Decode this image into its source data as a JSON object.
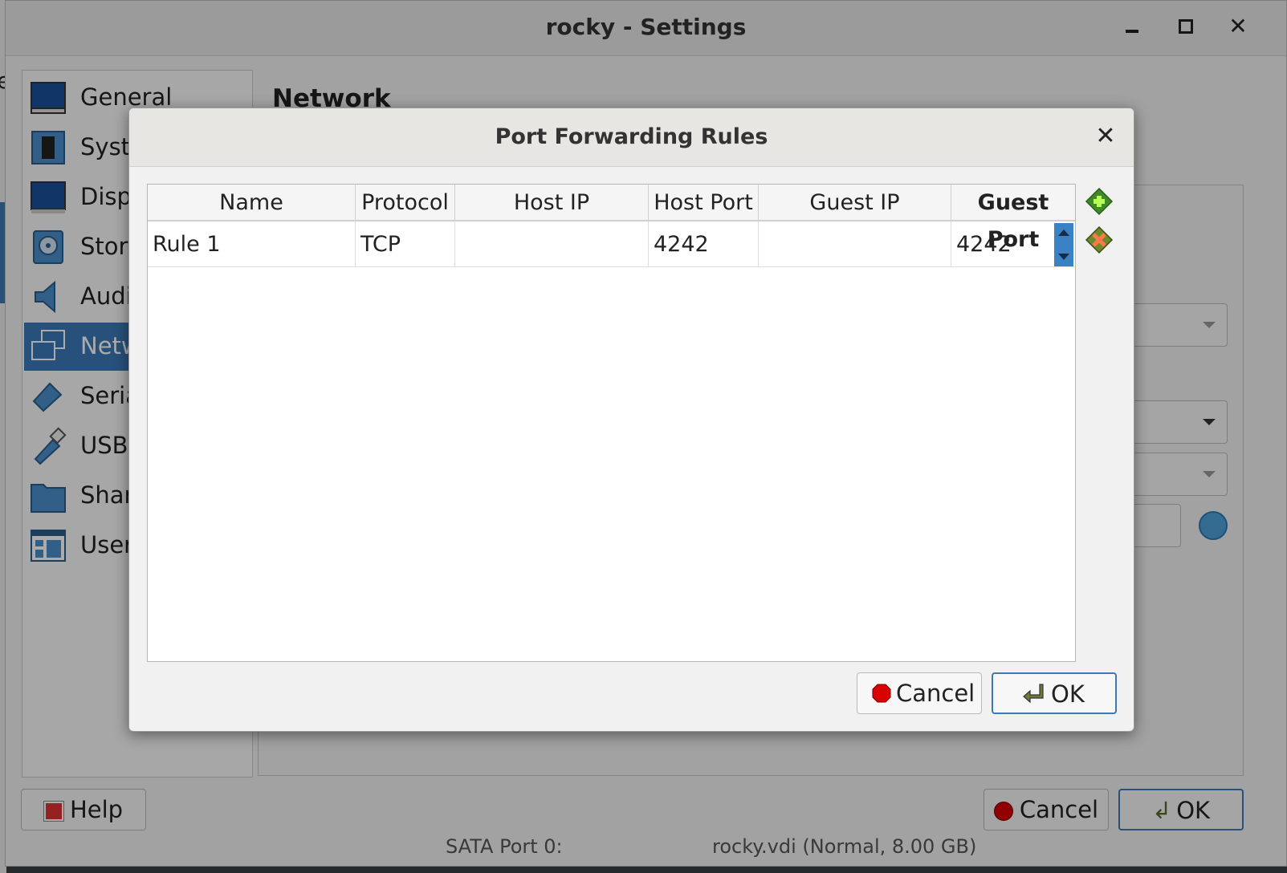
{
  "window": {
    "title": "rocky - Settings",
    "partial_left_edge_text": "e"
  },
  "sidebar": {
    "items": [
      {
        "label": "General",
        "icon": "monitor-general-icon"
      },
      {
        "label": "System",
        "icon": "chip-icon"
      },
      {
        "label": "Display",
        "icon": "display-icon"
      },
      {
        "label": "Storage",
        "icon": "disk-icon"
      },
      {
        "label": "Audio",
        "icon": "speaker-icon"
      },
      {
        "label": "Network",
        "icon": "network-icon",
        "selected": true
      },
      {
        "label": "Serial Ports",
        "icon": "serial-port-icon"
      },
      {
        "label": "USB",
        "icon": "usb-icon"
      },
      {
        "label": "Shared Folders",
        "icon": "folder-icon"
      },
      {
        "label": "User Interface",
        "icon": "user-interface-icon"
      }
    ],
    "visible_labels": [
      "General",
      "Syste",
      "Displ",
      "Stora",
      "Audi",
      "Netw",
      "Seria",
      "USB",
      "Share",
      "User"
    ]
  },
  "main": {
    "section_title": "Network"
  },
  "bottom_bar": {
    "help_label": "Help",
    "cancel_label": "Cancel",
    "ok_label": "OK",
    "partial_text_left": "SATA Port 0:",
    "partial_text_right": "rocky.vdi (Normal, 8.00 GB)"
  },
  "dialog": {
    "title": "Port Forwarding Rules",
    "columns": [
      "Name",
      "Protocol",
      "Host IP",
      "Host Port",
      "Guest IP",
      "Guest Port"
    ],
    "rows": [
      {
        "name": "Rule 1",
        "protocol": "TCP",
        "host_ip": "",
        "host_port": "4242",
        "guest_ip": "",
        "guest_port": "4242"
      }
    ],
    "cancel_label": "Cancel",
    "ok_label": "OK",
    "icons": {
      "add_rule": "add-rule-icon",
      "remove_rule": "remove-rule-icon",
      "close": "close-icon"
    }
  },
  "colors": {
    "accent": "#3b79b7",
    "spin_button": "#3b82c4"
  }
}
